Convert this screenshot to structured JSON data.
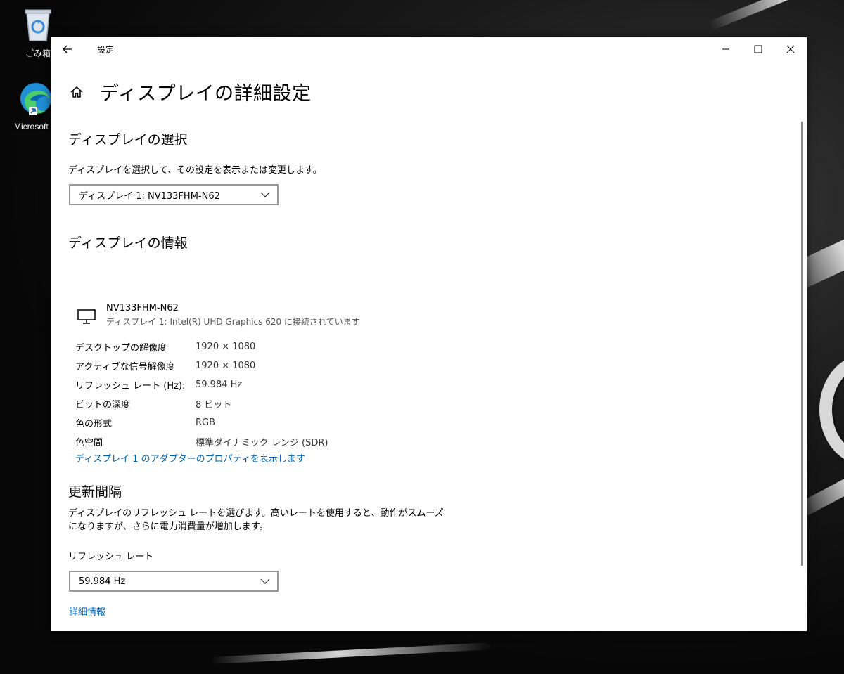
{
  "desktop": {
    "recycle_bin_label": "ごみ箱",
    "edge_label": "Microsoft E"
  },
  "window": {
    "title": "設定",
    "page_title": "ディスプレイの詳細設定"
  },
  "display_select": {
    "heading": "ディスプレイの選択",
    "description": "ディスプレイを選択して、その設定を表示または変更します。",
    "selected": "ディスプレイ 1: NV133FHM-N62"
  },
  "display_info": {
    "heading": "ディスプレイの情報",
    "monitor_name": "NV133FHM-N62",
    "monitor_subtitle": "ディスプレイ 1: Intel(R) UHD Graphics 620 に接続されています",
    "rows": [
      {
        "key": "デスクトップの解像度",
        "value": "1920 × 1080"
      },
      {
        "key": "アクティブな信号解像度",
        "value": "1920 × 1080"
      },
      {
        "key": "リフレッシュ レート (Hz):",
        "value": "59.984 Hz"
      },
      {
        "key": "ビットの深度",
        "value": "8 ビット"
      },
      {
        "key": "色の形式",
        "value": "RGB"
      },
      {
        "key": "色空間",
        "value": "標準ダイナミック レンジ (SDR)"
      }
    ],
    "adapter_link": "ディスプレイ 1 のアダプターのプロパティを表示します"
  },
  "refresh": {
    "heading": "更新間隔",
    "description_line1": "ディスプレイのリフレッシュ レートを選びます。高いレートを使用すると、動作がスムーズ",
    "description_line2": "になりますが、さらに電力消費量が増加します。",
    "label": "リフレッシュ レート",
    "selected": "59.984 Hz",
    "details_link": "詳細情報"
  }
}
